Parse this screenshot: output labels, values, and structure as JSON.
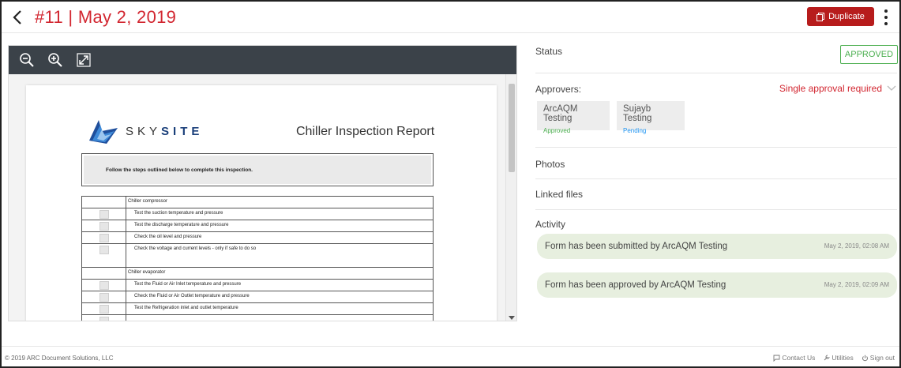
{
  "header": {
    "title": "#11 | May 2, 2019",
    "duplicate_label": "Duplicate"
  },
  "document": {
    "logo_text_light": "SKY",
    "logo_text_bold": "SITE",
    "report_title": "Chiller Inspection Report",
    "instructions": "Follow the steps outlined below to complete this inspection.",
    "checklist": [
      {
        "type": "section",
        "text": "Chiller compressor"
      },
      {
        "type": "item",
        "text": "Test the suction temperature and pressure"
      },
      {
        "type": "item",
        "text": "Test the discharge temperature and pressure"
      },
      {
        "type": "item",
        "text": "Check the oil level and pressure"
      },
      {
        "type": "item-tall",
        "text": "Check the voltage and current levels - only if safe to do so"
      },
      {
        "type": "section",
        "text": "Chiller evaporator"
      },
      {
        "type": "item",
        "text": "Test the Fluid or Air Inlet temperature and pressure"
      },
      {
        "type": "item",
        "text": "Check the Fluid or Air Outlet temperature and pressure"
      },
      {
        "type": "item",
        "text": "Test the Refrigeration inlet and outlet temperature"
      },
      {
        "type": "item",
        "text": ""
      }
    ]
  },
  "status": {
    "label": "Status",
    "value": "APPROVED"
  },
  "approvers": {
    "label": "Approvers:",
    "requirement": "Single approval required",
    "list": [
      {
        "name": "ArcAQM Testing",
        "status": "Approved",
        "color": "#4caf50"
      },
      {
        "name": "Sujayb Testing",
        "status": "Pending",
        "color": "#2196f3"
      }
    ]
  },
  "sections": {
    "photos": "Photos",
    "linked_files": "Linked files",
    "activity": "Activity"
  },
  "activity": [
    {
      "text": "Form has been submitted by ArcAQM Testing",
      "time": "May 2, 2019, 02:08 AM"
    },
    {
      "text": "Form has been approved by ArcAQM Testing",
      "time": "May 2, 2019, 02:09 AM"
    }
  ],
  "footer": {
    "copyright": "© 2019 ARC Document Solutions, LLC",
    "contact": "Contact Us",
    "utilities": "Utilities",
    "signout": "Sign out"
  },
  "colors": {
    "accent": "#d22630",
    "duplicate_bg": "#b71c1c",
    "approved": "#4caf50",
    "pending": "#2196f3",
    "activity_bg": "#e7efdf"
  }
}
